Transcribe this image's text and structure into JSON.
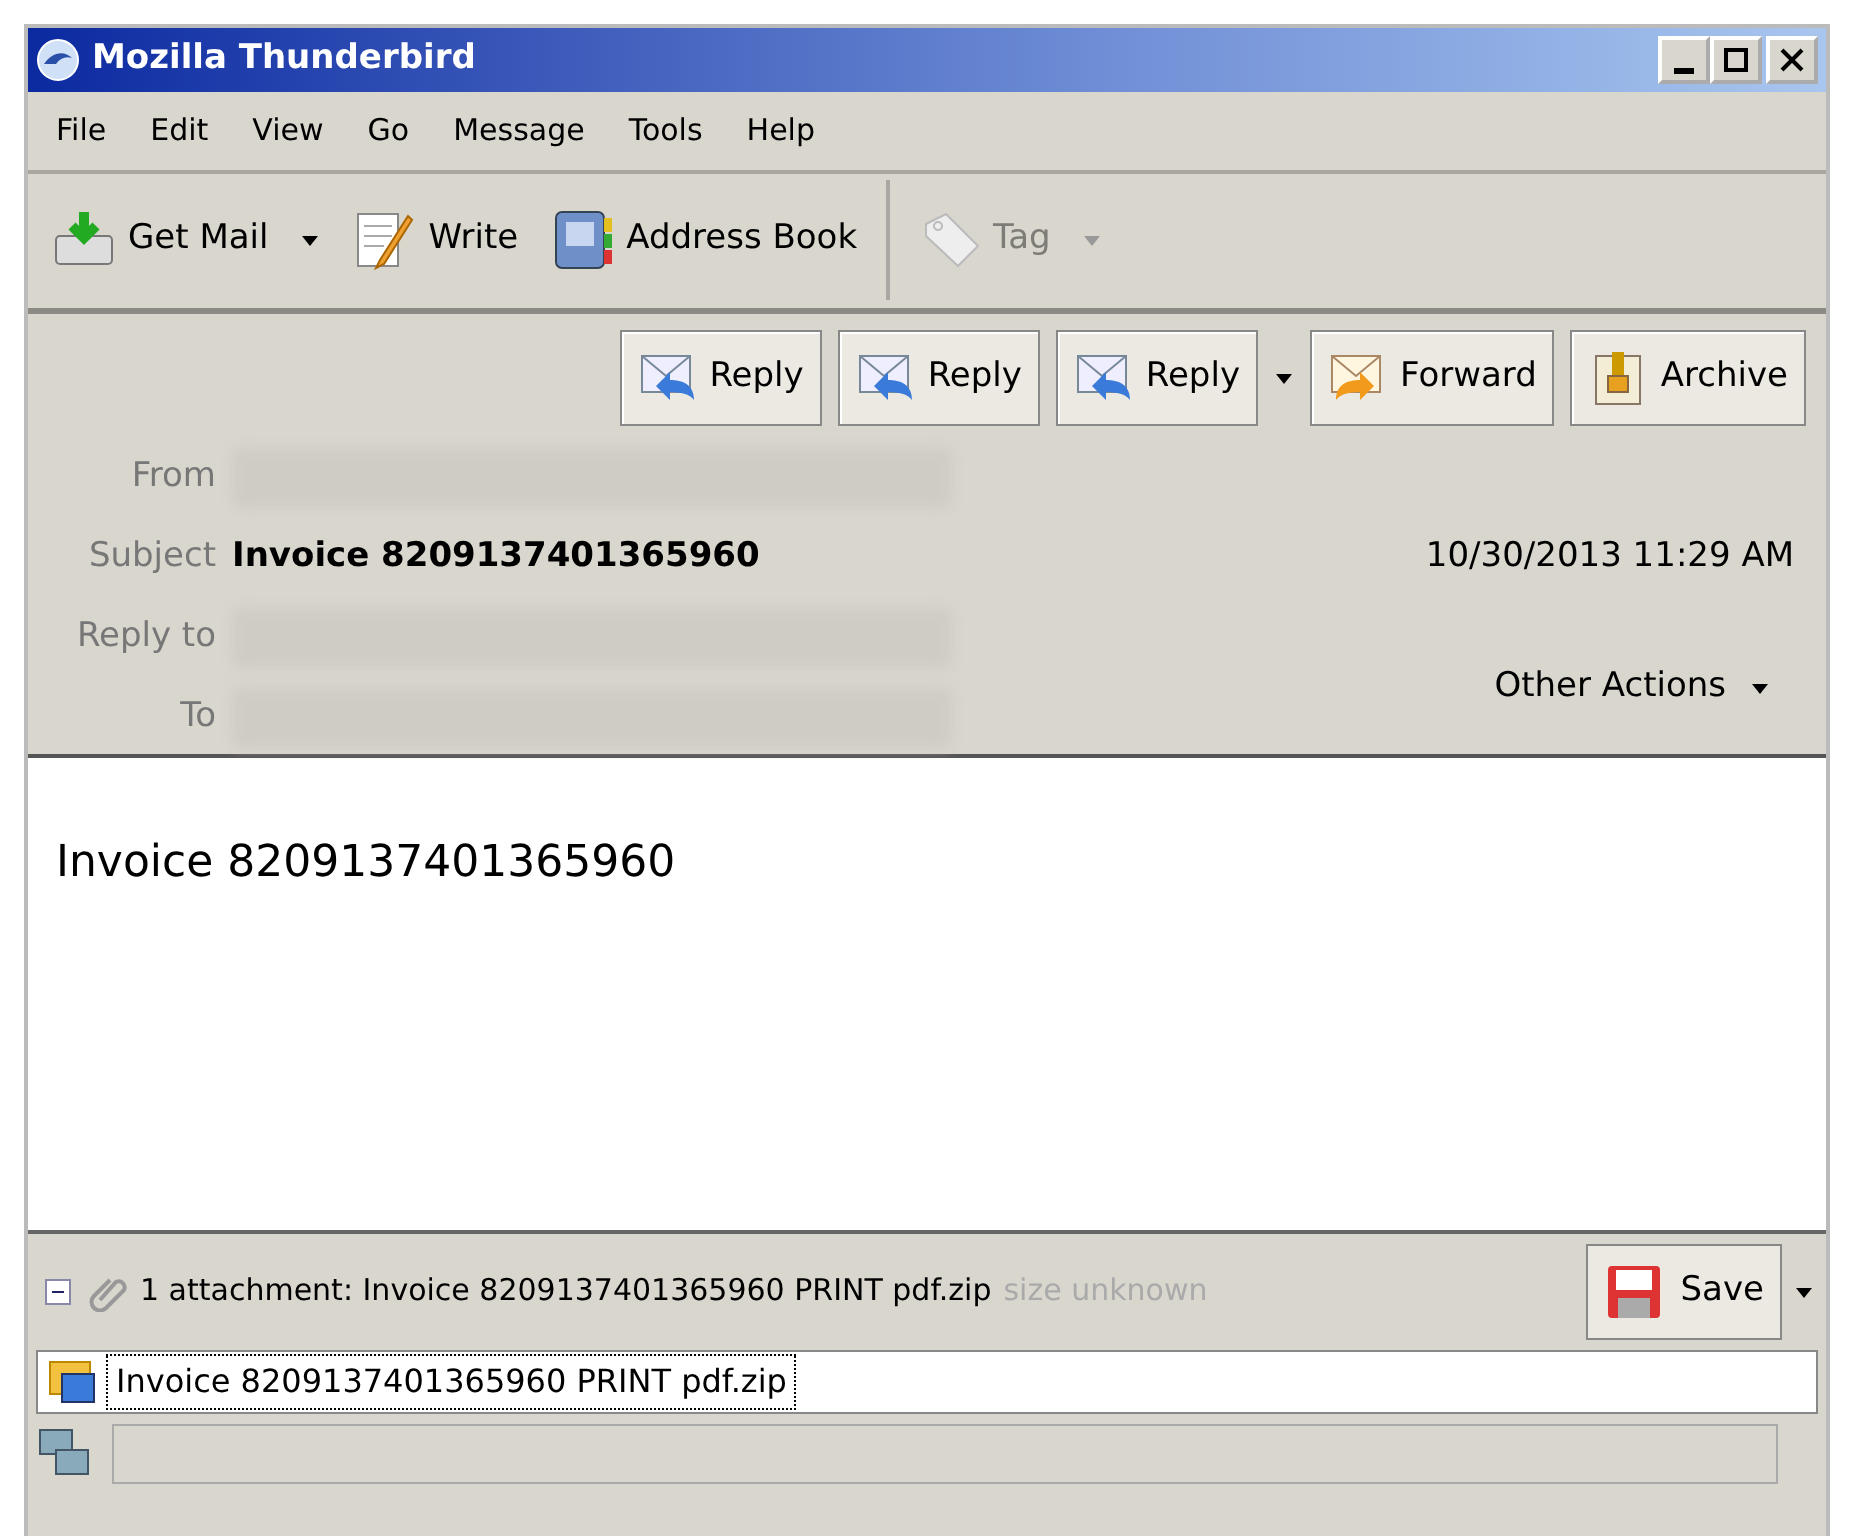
{
  "window": {
    "title": "Mozilla Thunderbird"
  },
  "menu": [
    "File",
    "Edit",
    "View",
    "Go",
    "Message",
    "Tools",
    "Help"
  ],
  "toolbar": [
    {
      "kind": "getmail",
      "label": "Get Mail",
      "dropdown": true,
      "disabled": false
    },
    {
      "kind": "write",
      "label": "Write",
      "dropdown": false,
      "disabled": false
    },
    {
      "kind": "addressbook",
      "label": "Address Book",
      "dropdown": false,
      "disabled": false
    },
    {
      "kind": "tag",
      "label": "Tag",
      "dropdown": true,
      "disabled": true
    }
  ],
  "message_buttons": [
    {
      "kind": "reply",
      "label": "Reply",
      "dropdown": false
    },
    {
      "kind": "reply",
      "label": "Reply",
      "dropdown": false
    },
    {
      "kind": "reply",
      "label": "Reply",
      "dropdown": true
    },
    {
      "kind": "forward",
      "label": "Forward",
      "dropdown": false
    },
    {
      "kind": "archive",
      "label": "Archive",
      "dropdown": false
    }
  ],
  "headers": [
    {
      "label": "From",
      "blurred": true
    },
    {
      "label": "Subject",
      "value": "Invoice 8209137401365960",
      "blurred": false
    },
    {
      "label": "Reply to",
      "blurred": true
    },
    {
      "label": "To",
      "blurred": true
    }
  ],
  "date": "10/30/2013 11:29 AM",
  "other_actions": "Other Actions",
  "body": "Invoice 8209137401365960",
  "attachment_bar": {
    "expanded": true,
    "summary": "1 attachment: Invoice 8209137401365960 PRINT pdf.zip",
    "size": "size unknown",
    "save": "Save"
  },
  "attachments": [
    {
      "name": "Invoice 8209137401365960 PRINT pdf.zip",
      "selected": true
    }
  ]
}
